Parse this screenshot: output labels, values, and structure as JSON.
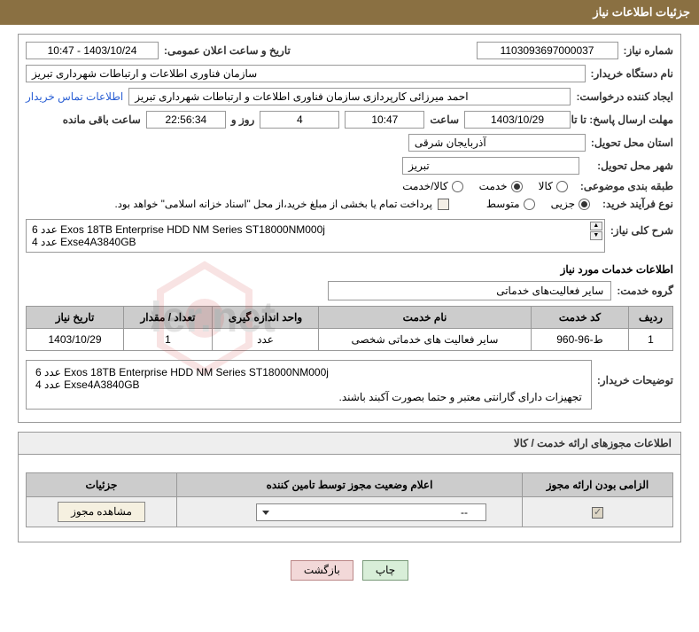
{
  "header": "جزئیات اطلاعات نیاز",
  "fields": {
    "needNumberLabel": "شماره نیاز:",
    "needNumber": "1103093697000037",
    "announceDateLabel": "تاریخ و ساعت اعلان عمومی:",
    "announceDate": "1403/10/24 - 10:47",
    "buyerOrgLabel": "نام دستگاه خریدار:",
    "buyerOrg": "سازمان فناوری اطلاعات و ارتباطات شهرداری تبریز",
    "requesterLabel": "ایجاد کننده درخواست:",
    "requester": "احمد میرزائی کارپردازی سازمان فناوری اطلاعات و ارتباطات شهرداری تبریز",
    "contactLink": "اطلاعات تماس خریدار",
    "deadlineLabel": "مهلت ارسال پاسخ: تا تاریخ:",
    "deadlineDate": "1403/10/29",
    "timeLabel": "ساعت",
    "deadlineTime": "10:47",
    "daysRemaining": "4",
    "daysText": "روز و",
    "countdown": "22:56:34",
    "remainingText": "ساعت باقی مانده",
    "provinceLabel": "استان محل تحویل:",
    "province": "آذربایجان شرقی",
    "cityLabel": "شهر محل تحویل:",
    "city": "تبریز",
    "categoryLabel": "طبقه بندی موضوعی:",
    "catGoods": "کالا",
    "catService": "خدمت",
    "catBoth": "کالا/خدمت",
    "purchaseTypeLabel": "نوع فرآیند خرید:",
    "ptMinor": "جزیی",
    "ptMedium": "متوسط",
    "paymentNote": "پرداخت تمام یا بخشی از مبلغ خرید،از محل \"اسناد خزانه اسلامی\" خواهد بود.",
    "generalDescLabel": "شرح کلی نیاز:",
    "generalDescLine1": "6 عدد Exos 18TB Enterprise HDD NM Series ST18000NM000j",
    "generalDescLine2": "4 عدد Exse4A3840GB",
    "servicesInfoTitle": "اطلاعات خدمات مورد نیاز",
    "serviceGroupLabel": "گروه خدمت:",
    "serviceGroup": "سایر فعالیت‌های خدماتی"
  },
  "table": {
    "headers": {
      "row": "ردیف",
      "code": "کد خدمت",
      "name": "نام خدمت",
      "unit": "واحد اندازه گیری",
      "qty": "تعداد / مقدار",
      "date": "تاریخ نیاز"
    },
    "rows": [
      {
        "row": "1",
        "code": "ط-96-960",
        "name": "سایر فعالیت های خدماتی شخصی",
        "unit": "عدد",
        "qty": "1",
        "date": "1403/10/29"
      }
    ]
  },
  "buyerDesc": {
    "label": "توضیحات خریدار:",
    "line1": "6 عدد Exos 18TB Enterprise HDD NM Series ST18000NM000j",
    "line2": "4 عدد Exse4A3840GB",
    "line3": "تجهیزات دارای گارانتی معتبر و حتما بصورت آکبند باشند."
  },
  "permitSection": {
    "title": "اطلاعات مجوزهای ارائه خدمت / کالا",
    "headers": {
      "mandatory": "الزامی بودن ارائه مجوز",
      "status": "اعلام وضعیت مجوز توسط تامین کننده",
      "details": "جزئیات"
    },
    "selectValue": "--",
    "viewBtn": "مشاهده مجوز"
  },
  "footer": {
    "print": "چاپ",
    "back": "بازگشت"
  }
}
